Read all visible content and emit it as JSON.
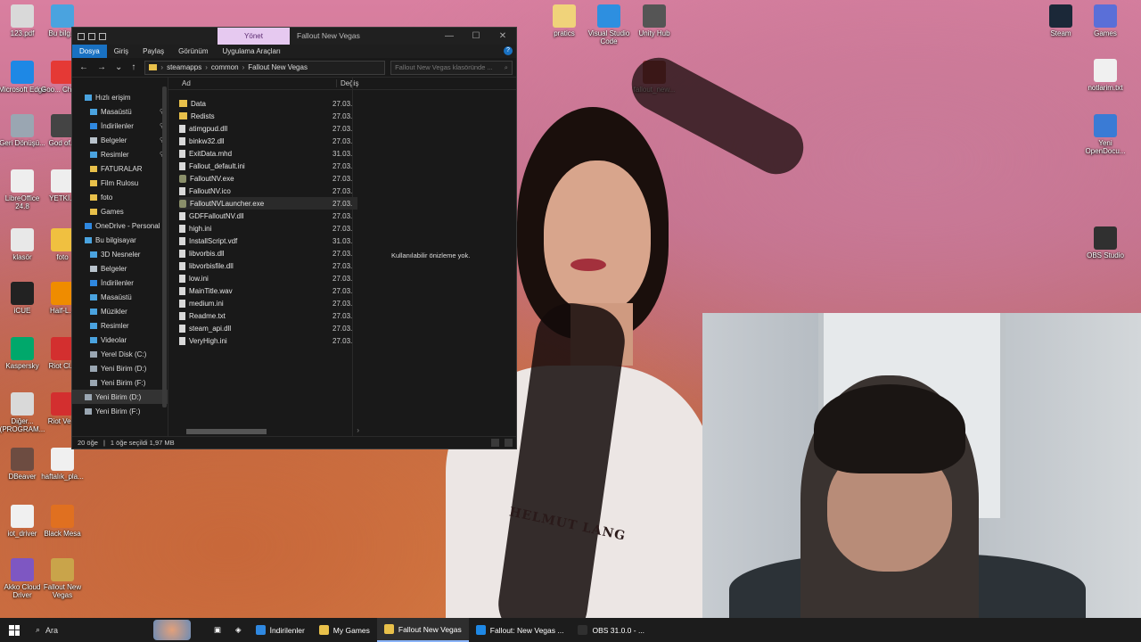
{
  "desktop": {
    "icons_left": [
      {
        "label": "123.pdf",
        "color": "#d9d9d9"
      },
      {
        "label": "Microsoft Edge",
        "color": "#1e88e5"
      },
      {
        "label": "Geri Dönüşü...",
        "color": "#9aa6b2"
      },
      {
        "label": "LibreOffice 24.8",
        "color": "#eeeeee"
      },
      {
        "label": "klasör",
        "color": "#e8e8e8"
      },
      {
        "label": "iCUE",
        "color": "#222222"
      },
      {
        "label": "Kaspersky",
        "color": "#00a86b"
      },
      {
        "label": "Diğer... (PROGRAM...",
        "color": "#d9d9d9"
      },
      {
        "label": "DBeaver",
        "color": "#6d4c41"
      },
      {
        "label": "iot_driver",
        "color": "#f0f0f0"
      },
      {
        "label": "Akko Cloud Driver",
        "color": "#7e57c2"
      }
    ],
    "icons_left2": [
      {
        "label": "Bu bilg...",
        "color": "#4aa3df"
      },
      {
        "label": "Goo... Chro...",
        "color": "#e53935"
      },
      {
        "label": "God of...",
        "color": "#444444"
      },
      {
        "label": "YETKİ...",
        "color": "#eeeeee"
      },
      {
        "label": "foto",
        "color": "#f0c040"
      },
      {
        "label": "Half-L...",
        "color": "#ef8c00"
      },
      {
        "label": "Riot Cl...",
        "color": "#d32f2f"
      },
      {
        "label": "Riot Ve...",
        "color": "#d32f2f"
      },
      {
        "label": "haftalık_pla...",
        "color": "#f0f0f0"
      },
      {
        "label": "Black Mesa",
        "color": "#e07020"
      },
      {
        "label": "Fallout New Vegas",
        "color": "#c9a44a"
      }
    ],
    "icons_top": [
      {
        "label": "pratics",
        "color": "#f0d37a"
      },
      {
        "label": "Visual Studio Code",
        "color": "#2d8fe0"
      },
      {
        "label": "Unity Hub",
        "color": "#555555"
      },
      {
        "label": "fallout_new...",
        "color": "#9b3b3b"
      }
    ],
    "icons_right": [
      {
        "label": "Steam",
        "color": "#1b2838"
      },
      {
        "label": "Games",
        "color": "#5a6fd8"
      },
      {
        "label": "notlarim.txt",
        "color": "#f0f0f0"
      },
      {
        "label": "Yeni OpenDocu...",
        "color": "#3a7bd5"
      },
      {
        "label": "OBS Studio",
        "color": "#303030"
      }
    ]
  },
  "explorer": {
    "manage_tab": "Yönet",
    "window_title": "Fallout New Vegas",
    "controls": {
      "minimize": "—",
      "maximize": "☐",
      "close": "✕"
    },
    "ribbon_tabs": [
      {
        "label": "Dosya",
        "active": true
      },
      {
        "label": "Giriş",
        "active": false
      },
      {
        "label": "Paylaş",
        "active": false
      },
      {
        "label": "Görünüm",
        "active": false
      },
      {
        "label": "Uygulama Araçları",
        "active": false
      }
    ],
    "help": "?",
    "nav": {
      "back": "←",
      "forward": "→",
      "down": "⌄",
      "up": "↑"
    },
    "breadcrumb": [
      "steamapps",
      "common",
      "Fallout New Vegas"
    ],
    "search_placeholder": "Fallout New Vegas klasöründe ...",
    "search_icon": "⌕",
    "nav_pane": [
      {
        "label": "Hızlı erişim",
        "icon": "#4aa3df",
        "indent": 0,
        "pin": false
      },
      {
        "label": "Masaüstü",
        "icon": "#4aa3df",
        "indent": 1,
        "pin": true
      },
      {
        "label": "İndirilenler",
        "icon": "#2f88e0",
        "indent": 1,
        "pin": true
      },
      {
        "label": "Belgeler",
        "icon": "#b9c3cc",
        "indent": 1,
        "pin": true
      },
      {
        "label": "Resimler",
        "icon": "#4aa3df",
        "indent": 1,
        "pin": true
      },
      {
        "label": "FATURALAR",
        "icon": "#e8c04a",
        "indent": 1,
        "pin": false
      },
      {
        "label": "Film Rulosu",
        "icon": "#e8c04a",
        "indent": 1,
        "pin": false
      },
      {
        "label": "foto",
        "icon": "#e8c04a",
        "indent": 1,
        "pin": false
      },
      {
        "label": "Games",
        "icon": "#e8c04a",
        "indent": 1,
        "pin": false
      },
      {
        "label": "OneDrive - Personal",
        "icon": "#2f88e0",
        "indent": 0,
        "pin": false
      },
      {
        "label": "Bu bilgisayar",
        "icon": "#4aa3df",
        "indent": 0,
        "pin": false
      },
      {
        "label": "3D Nesneler",
        "icon": "#4aa3df",
        "indent": 1,
        "pin": false
      },
      {
        "label": "Belgeler",
        "icon": "#b9c3cc",
        "indent": 1,
        "pin": false
      },
      {
        "label": "İndirilenler",
        "icon": "#2f88e0",
        "indent": 1,
        "pin": false
      },
      {
        "label": "Masaüstü",
        "icon": "#4aa3df",
        "indent": 1,
        "pin": false
      },
      {
        "label": "Müzikler",
        "icon": "#4aa3df",
        "indent": 1,
        "pin": false
      },
      {
        "label": "Resimler",
        "icon": "#4aa3df",
        "indent": 1,
        "pin": false
      },
      {
        "label": "Videolar",
        "icon": "#4aa3df",
        "indent": 1,
        "pin": false
      },
      {
        "label": "Yerel Disk (C:)",
        "icon": "#9aa6b2",
        "indent": 1,
        "pin": false
      },
      {
        "label": "Yeni Birim (D:)",
        "icon": "#9aa6b2",
        "indent": 1,
        "pin": false
      },
      {
        "label": "Yeni Birim (F:)",
        "icon": "#9aa6b2",
        "indent": 1,
        "pin": false
      },
      {
        "label": "Yeni Birim (D:)",
        "icon": "#9aa6b2",
        "indent": 0,
        "pin": false,
        "selected": true
      },
      {
        "label": "Yeni Birim (F:)",
        "icon": "#9aa6b2",
        "indent": 0,
        "pin": false
      }
    ],
    "columns": {
      "name": "Ad",
      "date": "Değiş"
    },
    "files": [
      {
        "name": "Data",
        "type": "folder",
        "date": "27.03."
      },
      {
        "name": "Redists",
        "type": "folder",
        "date": "27.03."
      },
      {
        "name": "atimgpud.dll",
        "type": "file",
        "date": "27.03."
      },
      {
        "name": "binkw32.dll",
        "type": "file",
        "date": "27.03."
      },
      {
        "name": "ExitData.mhd",
        "type": "file",
        "date": "31.03."
      },
      {
        "name": "Fallout_default.ini",
        "type": "file",
        "date": "27.03."
      },
      {
        "name": "FalloutNV.exe",
        "type": "exe",
        "date": "27.03."
      },
      {
        "name": "FalloutNV.ico",
        "type": "file",
        "date": "27.03."
      },
      {
        "name": "FalloutNVLauncher.exe",
        "type": "exe",
        "date": "27.03.",
        "highlighted": true
      },
      {
        "name": "GDFFalloutNV.dll",
        "type": "file",
        "date": "27.03."
      },
      {
        "name": "high.ini",
        "type": "file",
        "date": "27.03."
      },
      {
        "name": "InstallScript.vdf",
        "type": "file",
        "date": "31.03."
      },
      {
        "name": "libvorbis.dll",
        "type": "file",
        "date": "27.03."
      },
      {
        "name": "libvorbisfile.dll",
        "type": "file",
        "date": "27.03."
      },
      {
        "name": "low.ini",
        "type": "file",
        "date": "27.03."
      },
      {
        "name": "MainTitle.wav",
        "type": "file",
        "date": "27.03."
      },
      {
        "name": "medium.ini",
        "type": "file",
        "date": "27.03."
      },
      {
        "name": "Readme.txt",
        "type": "file",
        "date": "27.03."
      },
      {
        "name": "steam_api.dll",
        "type": "file",
        "date": "27.03."
      },
      {
        "name": "VeryHigh.ini",
        "type": "file",
        "date": "27.03."
      }
    ],
    "preview_text": "Kullanılabilir önizleme yok.",
    "status": {
      "count": "20 öğe",
      "selection": "1 öğe seçildi  1,97 MB"
    }
  },
  "taskbar": {
    "search_label": "Ara",
    "items": [
      {
        "label": "İndirilenler",
        "color": "#2f88e0",
        "active": false
      },
      {
        "label": "My Games",
        "color": "#e8c04a",
        "active": false
      },
      {
        "label": "Fallout New Vegas",
        "color": "#e8c04a",
        "active": true
      },
      {
        "label": "Fallout: New Vegas ...",
        "color": "#1e88e5",
        "active": false
      },
      {
        "label": "OBS 31.0.0 - ...",
        "color": "#303030",
        "active": false
      }
    ]
  },
  "portrait": {
    "logo": "HELMUT LANG"
  }
}
